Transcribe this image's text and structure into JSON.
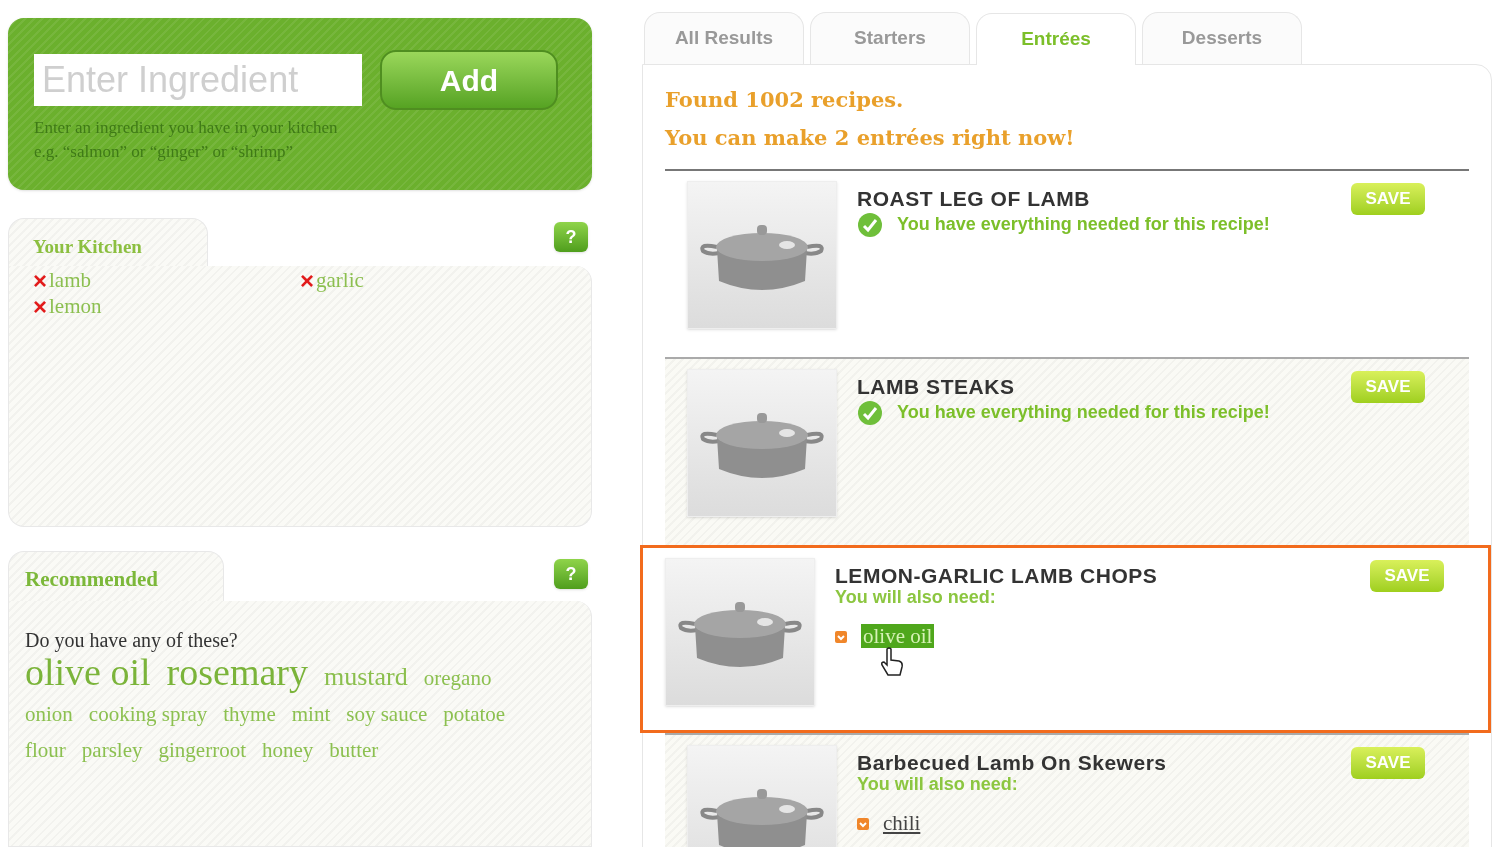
{
  "ingredient_form": {
    "placeholder": "Enter Ingredient",
    "button": "Add",
    "hint_lines": [
      "Enter an ingredient you have in your kitchen",
      "e.g. “salmon” or “ginger” or “shrimp”"
    ]
  },
  "kitchen": {
    "title": "Your Kitchen",
    "help": "?",
    "items": [
      {
        "remove": "×",
        "name": "lamb"
      },
      {
        "remove": "×",
        "name": "garlic"
      },
      {
        "remove": "×",
        "name": "lemon"
      }
    ]
  },
  "recommended": {
    "title": "Recommended",
    "help": "?",
    "question": "Do you have any of these?",
    "tags": [
      {
        "text": "olive oil",
        "kind": "large"
      },
      {
        "text": "rosemary",
        "kind": "large"
      },
      {
        "text": "mustard",
        "kind": "medium"
      },
      {
        "text": "oregano",
        "kind": "small"
      },
      {
        "text": "onion",
        "kind": "small"
      },
      {
        "text": "cooking spray",
        "kind": "small"
      },
      {
        "text": "thyme",
        "kind": "small"
      },
      {
        "text": "mint",
        "kind": "small"
      },
      {
        "text": "soy sauce",
        "kind": "small"
      },
      {
        "text": "potatoe",
        "kind": "small"
      },
      {
        "text": "flour",
        "kind": "small"
      },
      {
        "text": "parsley",
        "kind": "small"
      },
      {
        "text": "gingerroot",
        "kind": "small"
      },
      {
        "text": "honey",
        "kind": "small"
      },
      {
        "text": "butter",
        "kind": "small"
      }
    ]
  },
  "tabs": [
    {
      "label": "All Results",
      "selected": false
    },
    {
      "label": "Starters",
      "selected": false
    },
    {
      "label": "Entrées",
      "selected": true
    },
    {
      "label": "Desserts",
      "selected": false
    }
  ],
  "summary": [
    "Found 1002 recipes.",
    "You can make **2** entrées right now!"
  ],
  "recipes": [
    {
      "title": "ROAST LEG OF LAMB",
      "save": "SAVE",
      "kind": "complete",
      "highlighted": false,
      "message": "You have everything needed for this recipe!"
    },
    {
      "title": "LAMB STEAKS",
      "save": "SAVE",
      "kind": "complete",
      "highlighted": false,
      "message": "You have everything needed for this recipe!"
    },
    {
      "title": "LEMON-GARLIC LAMB CHOPS",
      "save": "SAVE",
      "kind": "missing",
      "highlighted": true,
      "message": "You will also need:",
      "needed": [
        {
          "name": "olive oil",
          "hovered": true
        }
      ]
    },
    {
      "title": "Barbecued Lamb On Skewers",
      "save": "SAVE",
      "kind": "missing",
      "highlighted": false,
      "message": "You will also need:",
      "needed": [
        {
          "name": "chili",
          "hovered": false
        }
      ]
    }
  ]
}
